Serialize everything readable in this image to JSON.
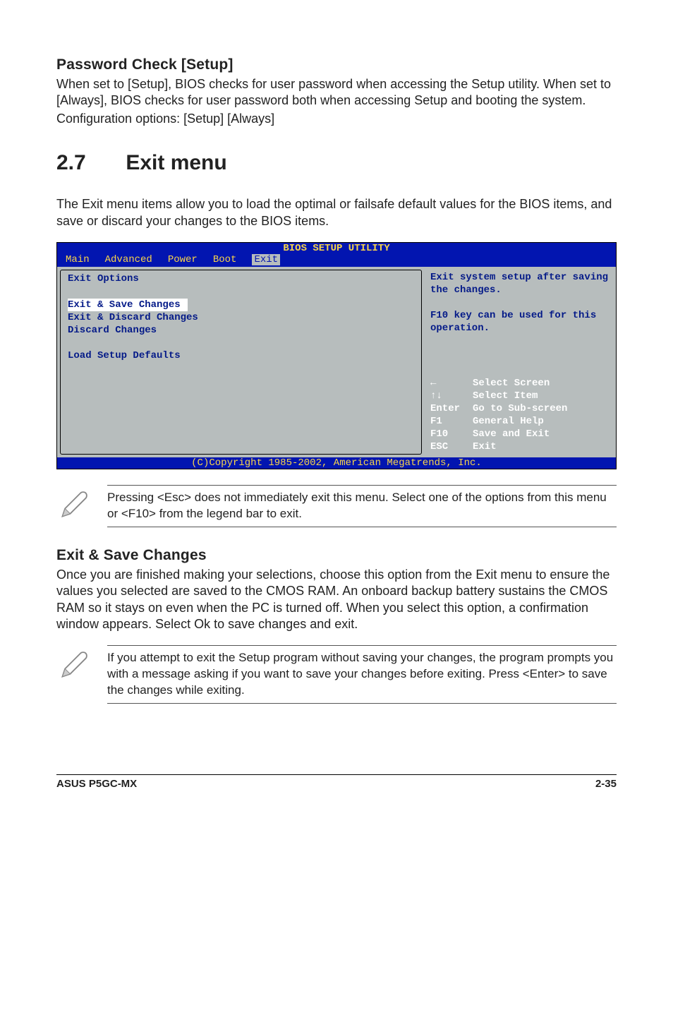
{
  "pwcheck": {
    "heading": "Password Check [Setup]",
    "para": "When set to [Setup], BIOS checks for user password when accessing the Setup utility. When set to [Always], BIOS checks for user password both when accessing Setup and booting the system.",
    "config": "Configuration options: [Setup] [Always]"
  },
  "chapter": {
    "num": "2.7",
    "title": "Exit menu"
  },
  "intro": "The Exit menu items allow you to load the optimal or failsafe default values for the BIOS items, and save or discard your changes to the BIOS items.",
  "bios": {
    "title": "BIOS SETUP UTILITY",
    "tabs": [
      "Main",
      "Advanced",
      "Power",
      "Boot",
      "Exit"
    ],
    "left_title": "Exit Options",
    "options": [
      "Exit & Save Changes",
      "Exit & Discard Changes",
      "Discard Changes",
      "",
      "Load Setup Defaults"
    ],
    "desc": "Exit system setup after saving the changes.\n\nF10 key can be used for this operation.",
    "keys": [
      {
        "k": "←",
        "a": "Select Screen"
      },
      {
        "k": "↑↓",
        "a": "Select Item"
      },
      {
        "k": "Enter",
        "a": "Go to Sub-screen"
      },
      {
        "k": "F1",
        "a": "General Help"
      },
      {
        "k": "F10",
        "a": "Save and Exit"
      },
      {
        "k": "ESC",
        "a": "Exit"
      }
    ],
    "footer": "(C)Copyright 1985-2002, American Megatrends, Inc."
  },
  "note1": "Pressing <Esc> does not immediately exit this menu. Select one of the options from this menu or <F10> from the legend bar to exit.",
  "exitsave": {
    "heading": "Exit & Save Changes",
    "para": "Once you are finished making your selections, choose this option from the Exit menu to ensure the values you selected are saved to the CMOS RAM. An onboard backup battery sustains the CMOS RAM so it stays on even when the PC is turned off. When you select this option, a confirmation window appears. Select Ok to save changes and exit."
  },
  "note2": " If you attempt to exit the Setup program without saving your changes, the program prompts you with a message asking if you want to save your changes before exiting. Press <Enter>  to save the  changes while exiting.",
  "footer": {
    "left": "ASUS P5GC-MX",
    "right": "2-35"
  }
}
